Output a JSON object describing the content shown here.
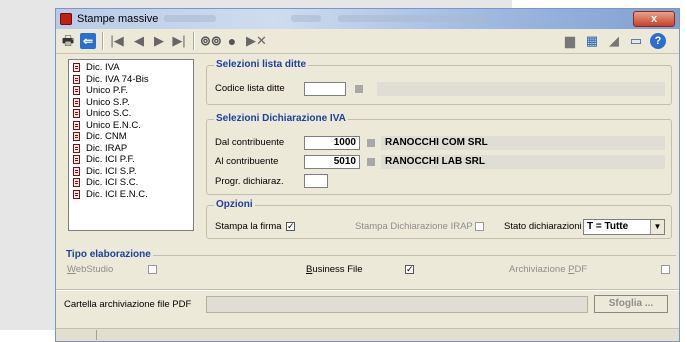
{
  "window": {
    "title": "Stampe massive",
    "close_label": "x"
  },
  "toolbar": {
    "icons": [
      "printer-icon",
      "back-icon",
      "first-icon",
      "prev-icon",
      "next-icon",
      "last-icon",
      "binoculars-icon",
      "record-icon",
      "skip-icon",
      "chat-icon",
      "calculator-icon",
      "eraser-icon",
      "window-icon",
      "help-icon"
    ]
  },
  "list": {
    "items": [
      "Dic. IVA",
      "Dic. IVA 74-Bis",
      "Unico P.F.",
      "Unico S.P.",
      "Unico S.C.",
      "Unico E.N.C.",
      "Dic. CNM",
      "Dic. IRAP",
      "Dic. ICI P.F.",
      "Dic. ICI S.P.",
      "Dic. ICI S.C.",
      "Dic. ICI E.N.C."
    ]
  },
  "selezioni_ditte": {
    "title": "Selezioni lista ditte",
    "codice_label": "Codice lista ditte",
    "codice_value": ""
  },
  "selezioni_iva": {
    "title": "Selezioni Dichiarazione IVA",
    "dal_label": "Dal contribuente",
    "dal_value": "1000",
    "dal_name": "RANOCCHI COM SRL",
    "al_label": "Al  contribuente",
    "al_value": "5010",
    "al_name": "RANOCCHI LAB SRL",
    "progr_label": "Progr. dichiaraz.",
    "progr_value": ""
  },
  "opzioni": {
    "title": "Opzioni",
    "firma_label": "Stampa la firma",
    "firma_checked": "✓",
    "irap_label": "Stampa Dichiarazione IRAP",
    "irap_checked": "",
    "stato_label": "Stato dichiarazioni",
    "stato_value": "T = Tutte"
  },
  "tipo": {
    "title": "Tipo elaborazione",
    "webstudio_u": "W",
    "webstudio_rest": "ebStudio",
    "webstudio_checked": "",
    "business_u": "B",
    "business_rest": "usiness File",
    "business_checked": "✓",
    "archiviazione_pre": "Archiviazione ",
    "archiviazione_u": "P",
    "archiviazione_post": "DF",
    "archiviazione_checked": ""
  },
  "cartella": {
    "label": "Cartella archiviazione file PDF",
    "value": "",
    "sfoglia_label": "Sfoglia ..."
  },
  "colors": {
    "group_title": "#1f3f9f",
    "window_bg": "#ece9d8",
    "close": "#c7402a"
  }
}
